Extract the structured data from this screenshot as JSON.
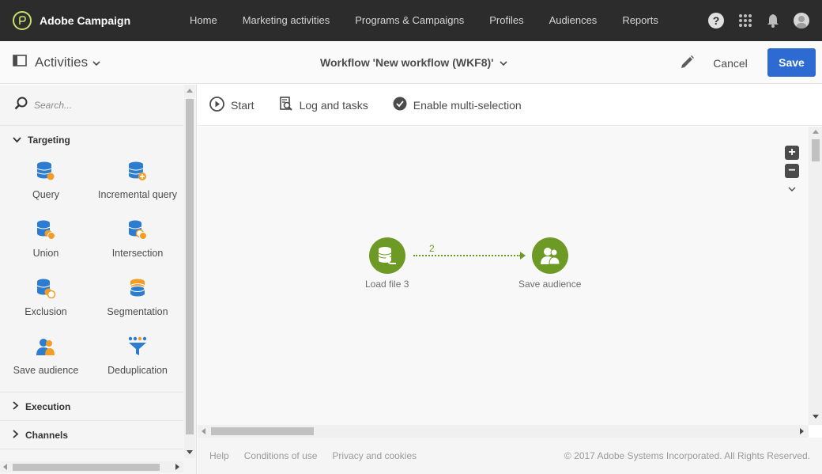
{
  "app": {
    "name": "Adobe Campaign",
    "nav": [
      "Home",
      "Marketing activities",
      "Programs & Campaigns",
      "Profiles",
      "Audiences",
      "Reports"
    ],
    "help_glyph": "?"
  },
  "header": {
    "panel_title": "Activities",
    "workflow_title": "Workflow 'New workflow (WKF8)'",
    "cancel_label": "Cancel",
    "save_label": "Save"
  },
  "sidebar": {
    "search_placeholder": "Search...",
    "sections": {
      "targeting": {
        "label": "Targeting",
        "items": [
          {
            "label": "Query",
            "icon": "query-icon"
          },
          {
            "label": "Incremental query",
            "icon": "incremental-query-icon"
          },
          {
            "label": "Union",
            "icon": "union-icon"
          },
          {
            "label": "Intersection",
            "icon": "intersection-icon"
          },
          {
            "label": "Exclusion",
            "icon": "exclusion-icon"
          },
          {
            "label": "Segmentation",
            "icon": "segmentation-icon"
          },
          {
            "label": "Save audience",
            "icon": "save-audience-icon"
          },
          {
            "label": "Deduplication",
            "icon": "deduplication-icon"
          }
        ]
      },
      "execution": {
        "label": "Execution"
      },
      "channels": {
        "label": "Channels"
      }
    }
  },
  "toolbar": {
    "start": "Start",
    "log": "Log and tasks",
    "multi": "Enable multi-selection"
  },
  "workflow": {
    "nodes": [
      {
        "label": "Load file 3",
        "icon": "load-file-icon"
      },
      {
        "label": "Save audience",
        "icon": "save-audience-icon"
      }
    ],
    "transition_count": "2"
  },
  "footer": {
    "help": "Help",
    "terms": "Conditions of use",
    "privacy": "Privacy and cookies",
    "copyright": "© 2017 Adobe Systems Incorporated. All Rights Reserved."
  },
  "colors": {
    "topbar": "#2c2c2c",
    "save_button": "#2d6bd3",
    "node_green": "#6c9a24",
    "icon_blue": "#2c7ccf",
    "icon_orange": "#f39c26"
  }
}
